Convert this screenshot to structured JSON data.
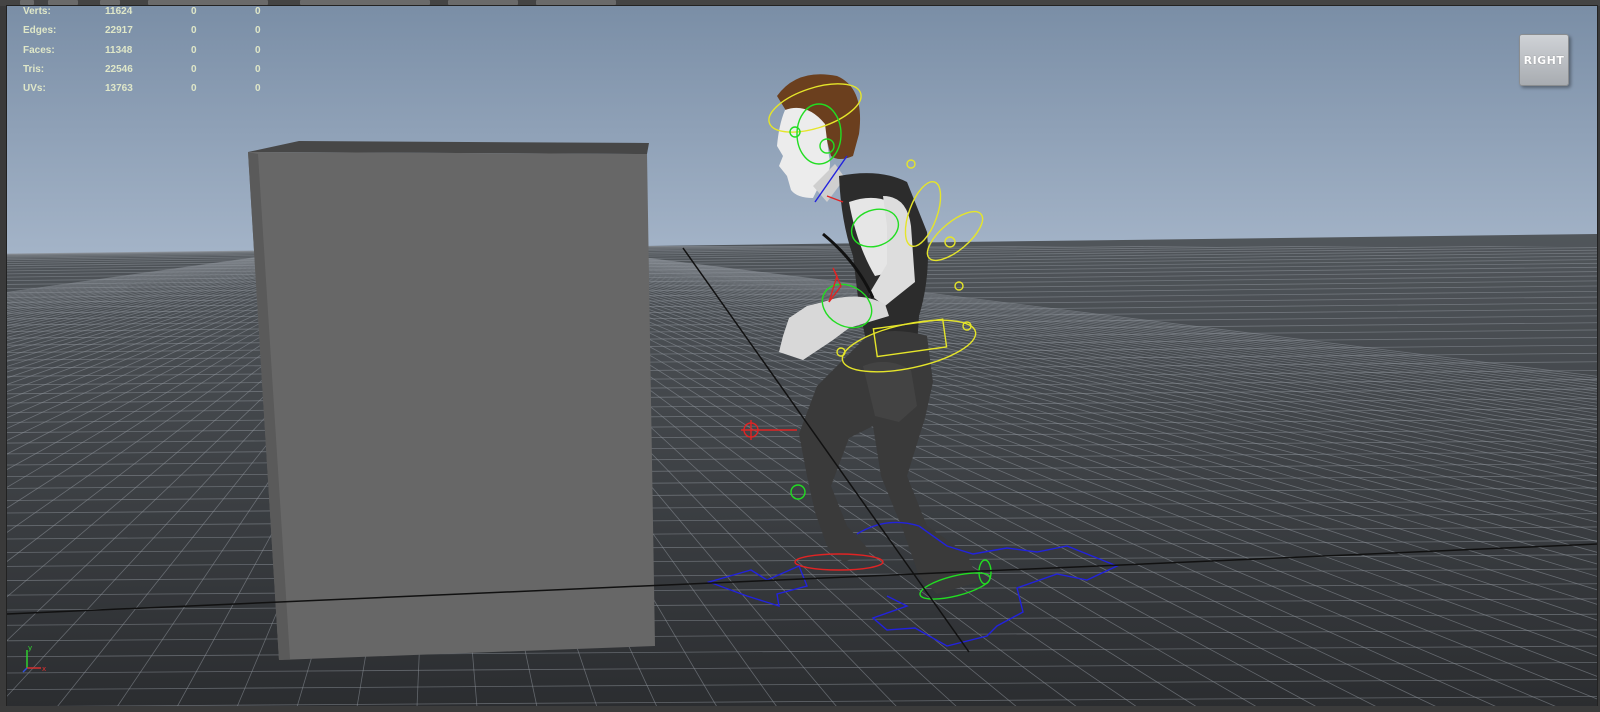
{
  "app": "Maya viewport",
  "hud": {
    "rows": [
      {
        "label": "Verts:",
        "v1": "11624",
        "v2": "0",
        "v3": "0"
      },
      {
        "label": "Edges:",
        "v1": "22917",
        "v2": "0",
        "v3": "0"
      },
      {
        "label": "Faces:",
        "v1": "11348",
        "v2": "0",
        "v3": "0"
      },
      {
        "label": "Tris:",
        "v1": "22546",
        "v2": "0",
        "v3": "0"
      },
      {
        "label": "UVs:",
        "v1": "13763",
        "v2": "0",
        "v3": "0"
      }
    ]
  },
  "viewcube": {
    "label": "RIGHT"
  },
  "axis": {
    "y_label": "y",
    "x_label": "x"
  },
  "colors": {
    "sky_top": "#7e93ab",
    "horizon": "#9fb0c6",
    "floor": "#3d4044",
    "grid_line": "#8f969c",
    "box_front": "#686868",
    "box_top": "#4a4a4a",
    "controls_green": "#22dd22",
    "controls_yellow": "#e7e72a",
    "controls_red": "#e02424",
    "controls_blue": "#2222dd"
  }
}
